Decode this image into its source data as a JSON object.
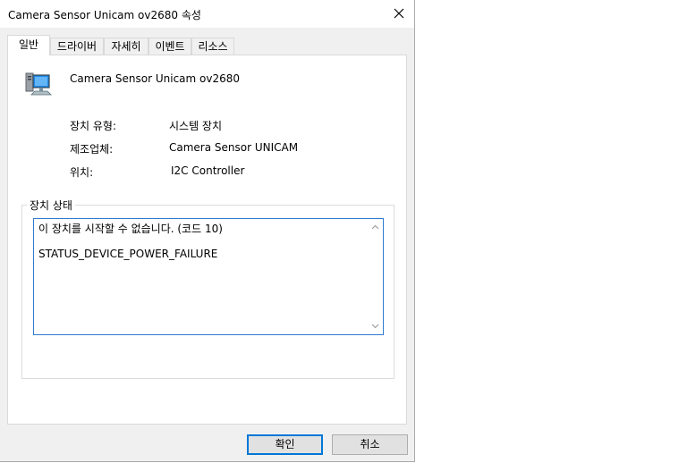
{
  "window": {
    "title": "Camera Sensor Unicam ov2680 속성"
  },
  "tabs": [
    {
      "label": "일반",
      "active": true
    },
    {
      "label": "드라이버",
      "active": false
    },
    {
      "label": "자세히",
      "active": false
    },
    {
      "label": "이벤트",
      "active": false
    },
    {
      "label": "리소스",
      "active": false
    }
  ],
  "device": {
    "icon": "device-icon",
    "name": "Camera Sensor Unicam ov2680"
  },
  "properties": {
    "type_label": "장치 유형:",
    "type_value": "시스템 장치",
    "manufacturer_label": "제조업체:",
    "manufacturer_value": "Camera Sensor UNICAM",
    "location_label": "위치:",
    "location_value": "I2C Controller"
  },
  "status": {
    "group_label": "장치 상태",
    "line1": "이 장치를 시작할 수 없습니다. (코드 10)",
    "line2": "STATUS_DEVICE_POWER_FAILURE"
  },
  "buttons": {
    "ok": "확인",
    "cancel": "취소"
  },
  "colors": {
    "accent": "#0078d7",
    "focus_border": "#2f7ad1"
  }
}
